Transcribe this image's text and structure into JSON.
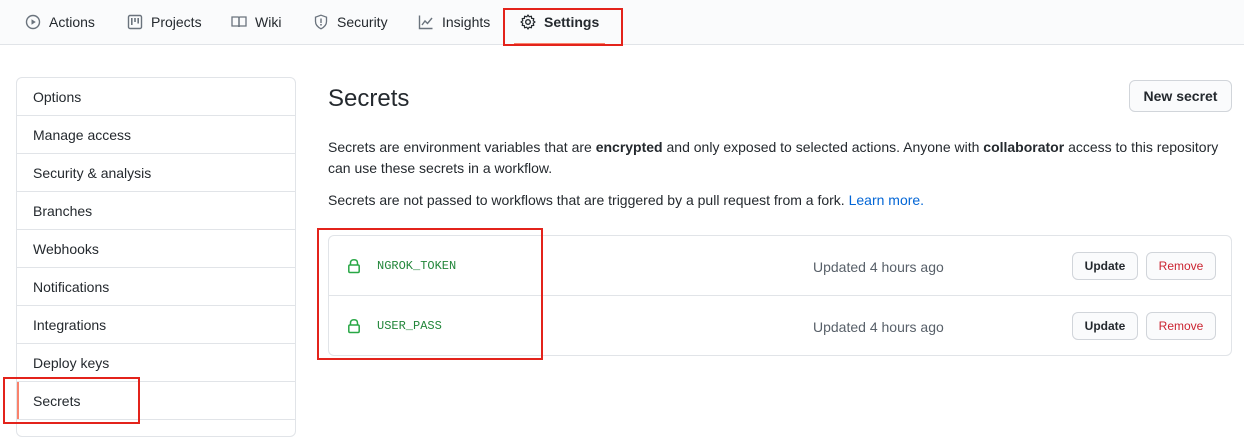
{
  "nav": {
    "tabs": [
      {
        "label": "Actions",
        "icon": "play-icon"
      },
      {
        "label": "Projects",
        "icon": "project-icon"
      },
      {
        "label": "Wiki",
        "icon": "book-icon"
      },
      {
        "label": "Security",
        "icon": "shield-icon"
      },
      {
        "label": "Insights",
        "icon": "graph-icon"
      },
      {
        "label": "Settings",
        "icon": "gear-icon",
        "selected": true
      }
    ]
  },
  "sidebar": {
    "items": [
      {
        "label": "Options"
      },
      {
        "label": "Manage access"
      },
      {
        "label": "Security & analysis"
      },
      {
        "label": "Branches"
      },
      {
        "label": "Webhooks"
      },
      {
        "label": "Notifications"
      },
      {
        "label": "Integrations"
      },
      {
        "label": "Deploy keys"
      },
      {
        "label": "Secrets",
        "selected": true
      }
    ]
  },
  "main": {
    "title": "Secrets",
    "new_secret_label": "New secret",
    "description": {
      "part1": "Secrets are environment variables that are ",
      "bold1": "encrypted",
      "part2": " and only exposed to selected actions. Anyone with ",
      "bold2": "collaborator",
      "part3": " access to this repository can use these secrets in a workflow."
    },
    "fork_note": "Secrets are not passed to workflows that are triggered by a pull request from a fork.",
    "learn_more": "Learn more.",
    "secrets": [
      {
        "name": "NGROK_TOKEN",
        "updated": "Updated 4 hours ago",
        "update_label": "Update",
        "remove_label": "Remove"
      },
      {
        "name": "USER_PASS",
        "updated": "Updated 4 hours ago",
        "update_label": "Update",
        "remove_label": "Remove"
      }
    ]
  },
  "colors": {
    "accent_underline": "#f9826c",
    "annotation_red": "#e3231b",
    "secret_green": "#22863a",
    "danger": "#cb2431",
    "link": "#0366d6"
  }
}
